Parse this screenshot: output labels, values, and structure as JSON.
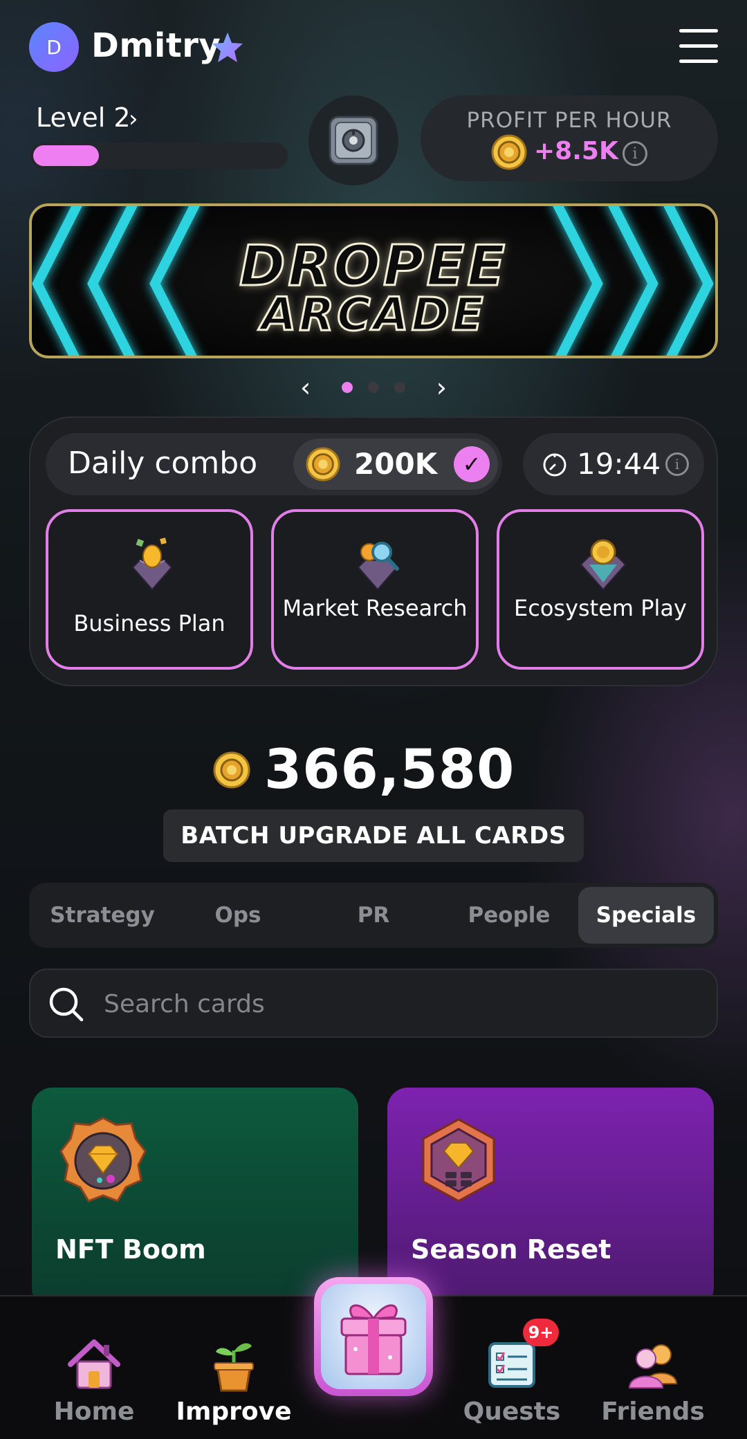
{
  "header": {
    "avatar_initial": "D",
    "username": "Dmitry",
    "icons": {
      "verified": "star-icon",
      "menu": "hamburger-menu-icon"
    }
  },
  "level": {
    "label": "Level 2",
    "chevron": "›",
    "progress_fraction": 0.26
  },
  "safe": {
    "icon": "safe-vault-icon"
  },
  "profit": {
    "title": "PROFIT PER HOUR",
    "value": "+8.5K",
    "icons": {
      "coin": "coin-icon",
      "info": "info-icon"
    },
    "info_glyph": "i"
  },
  "banner": {
    "line1": "DROPEE",
    "line2": "ARCADE"
  },
  "carousel": {
    "prev": "‹",
    "next": "›",
    "slide_count": 3,
    "active_index": 0
  },
  "daily_combo": {
    "label": "Daily combo",
    "reward": "200K",
    "check_glyph": "✓",
    "timer": "19:44",
    "info_glyph": "i",
    "cards": [
      {
        "name": "Business Plan",
        "icon": "golden-egg-gem-icon"
      },
      {
        "name": "Market Research",
        "icon": "magnifier-gem-icon"
      },
      {
        "name": "Ecosystem Play",
        "icon": "coin-gem-icon"
      }
    ]
  },
  "balance": {
    "value": "366,580"
  },
  "batch_button": {
    "label": "BATCH UPGRADE ALL CARDS"
  },
  "tabs": {
    "items": [
      "Strategy",
      "Ops",
      "PR",
      "People",
      "Specials"
    ],
    "active": "Specials"
  },
  "search": {
    "placeholder": "Search cards",
    "value": ""
  },
  "cards": [
    {
      "title": "NFT Boom",
      "icon": "diamond-badge-icon",
      "color": "#0d5a3e"
    },
    {
      "title": "Season Reset",
      "icon": "diamond-hexagon-icon",
      "color": "#7d22b0"
    }
  ],
  "nav": {
    "items": [
      {
        "label": "Home",
        "icon": "house-icon",
        "active": false
      },
      {
        "label": "Improve",
        "icon": "sprout-pot-icon",
        "active": true
      },
      {
        "label": "",
        "icon": "gift-box-icon",
        "active": false
      },
      {
        "label": "Quests",
        "icon": "checklist-scroll-icon",
        "active": false
      },
      {
        "label": "Friends",
        "icon": "friends-icon",
        "active": false
      }
    ],
    "quests_badge": "9+"
  },
  "colors": {
    "accent_pink": "#ec80f0",
    "coin_gold": "#e9b23a",
    "nft_card": "#0d5a3e",
    "season_card": "#7d22b0",
    "badge_red": "#ee2a3c"
  }
}
